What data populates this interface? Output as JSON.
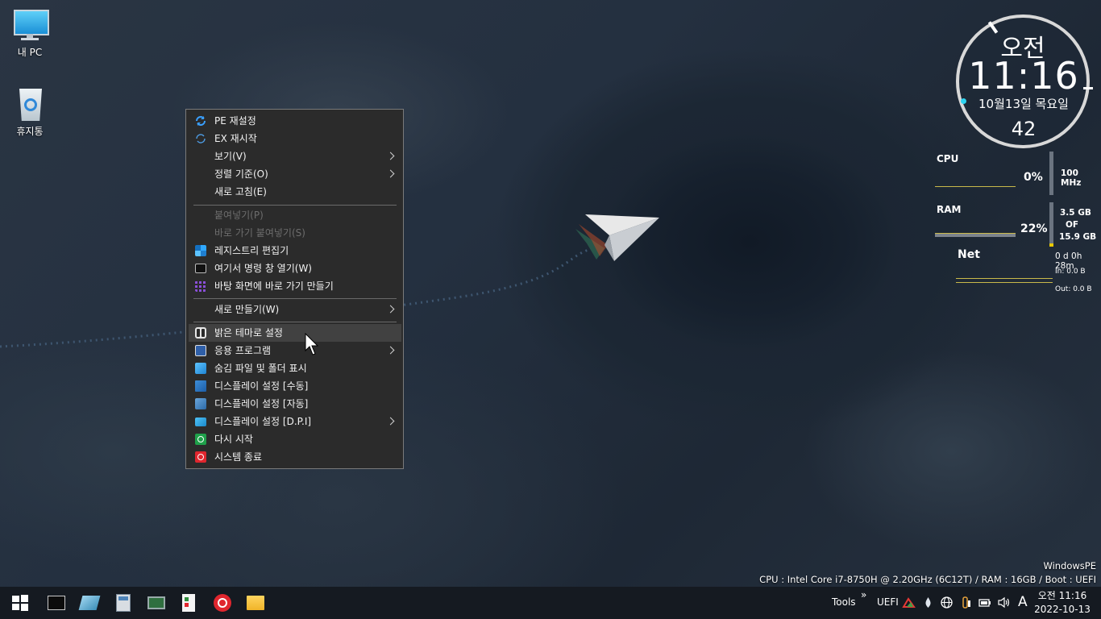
{
  "desktop": {
    "icons": [
      {
        "label": "내 PC",
        "icon": "monitor-icon"
      },
      {
        "label": "휴지통",
        "icon": "recycle-bin-icon"
      }
    ]
  },
  "context_menu": {
    "items": [
      {
        "label": "PE 재설정",
        "icon": "refresh-icon",
        "enabled": true,
        "submenu": false
      },
      {
        "label": "EX 재시작",
        "icon": "restart-icon",
        "enabled": true,
        "submenu": false
      },
      {
        "label": "보기(V)",
        "icon": "",
        "enabled": true,
        "submenu": true
      },
      {
        "label": "정렬 기준(O)",
        "icon": "",
        "enabled": true,
        "submenu": true
      },
      {
        "label": "새로 고침(E)",
        "icon": "",
        "enabled": true,
        "submenu": false
      },
      {
        "label": "붙여넣기(P)",
        "icon": "",
        "enabled": false,
        "submenu": false
      },
      {
        "label": "바로 가기 붙여넣기(S)",
        "icon": "",
        "enabled": false,
        "submenu": false
      },
      {
        "label": "레지스트리 편집기",
        "icon": "registry-icon",
        "enabled": true,
        "submenu": false
      },
      {
        "label": "여기서 명령 창 열기(W)",
        "icon": "cmd-icon",
        "enabled": true,
        "submenu": false
      },
      {
        "label": "바탕 화면에 바로 가기 만들기",
        "icon": "grid-icon",
        "enabled": true,
        "submenu": false
      },
      {
        "label": "새로 만들기(W)",
        "icon": "",
        "enabled": true,
        "submenu": true
      },
      {
        "label": "밝은 테마로 설정",
        "icon": "theme-toggle-icon",
        "enabled": true,
        "submenu": false,
        "highlighted": true
      },
      {
        "label": "응용 프로그램",
        "icon": "apps-icon",
        "enabled": true,
        "submenu": true
      },
      {
        "label": "숨김 파일 및 폴더 표시",
        "icon": "hidden-files-icon",
        "enabled": true,
        "submenu": false
      },
      {
        "label": "디스플레이 설정 [수동]",
        "icon": "display-manual-icon",
        "enabled": true,
        "submenu": false
      },
      {
        "label": "디스플레이 설정 [자동]",
        "icon": "display-auto-icon",
        "enabled": true,
        "submenu": false
      },
      {
        "label": "디스플레이 설정 [D.P.I]",
        "icon": "display-dpi-icon",
        "enabled": true,
        "submenu": true
      },
      {
        "label": "다시 시작",
        "icon": "reboot-icon",
        "enabled": true,
        "submenu": false
      },
      {
        "label": "시스템 종료",
        "icon": "shutdown-icon",
        "enabled": true,
        "submenu": false
      }
    ]
  },
  "clock_gadget": {
    "ampm": "오전",
    "time": "11:16",
    "date": "10월13일 목요일",
    "seconds": "42"
  },
  "monitor": {
    "cpu": {
      "label": "CPU",
      "percent": "0%",
      "freq": "100 MHz"
    },
    "ram": {
      "label": "RAM",
      "percent": "22%",
      "used": "3.5 GB",
      "of": "OF",
      "total": "15.9 GB",
      "fill_fraction": 0.22
    },
    "net": {
      "label": "Net",
      "uptime": "0 d 0h 28m",
      "in": "In: 0.0 B",
      "out": "Out: 0.0 B"
    }
  },
  "system_info": {
    "os": "WindowsPE",
    "hardware": "CPU : Intel Core i7-8750H @ 2.20GHz (6C12T) / RAM : 16GB / Boot : UEFI"
  },
  "taskbar": {
    "start_icon": "windows-start-icon",
    "pinned": [
      {
        "name": "command-prompt",
        "icon": "cmd-icon"
      },
      {
        "name": "eraser-tool",
        "icon": "eraser-icon"
      },
      {
        "name": "calculator",
        "icon": "calculator-icon"
      },
      {
        "name": "hardware-info",
        "icon": "circuit-board-icon"
      },
      {
        "name": "installer",
        "icon": "installer-icon"
      },
      {
        "name": "power",
        "icon": "power-icon"
      },
      {
        "name": "file-explorer",
        "icon": "folder-icon"
      }
    ],
    "tools_label": "Tools",
    "chevron": "»",
    "uefi_label": "UEFI",
    "ime": "A",
    "time": "오전 11:16",
    "date": "2022-10-13"
  }
}
